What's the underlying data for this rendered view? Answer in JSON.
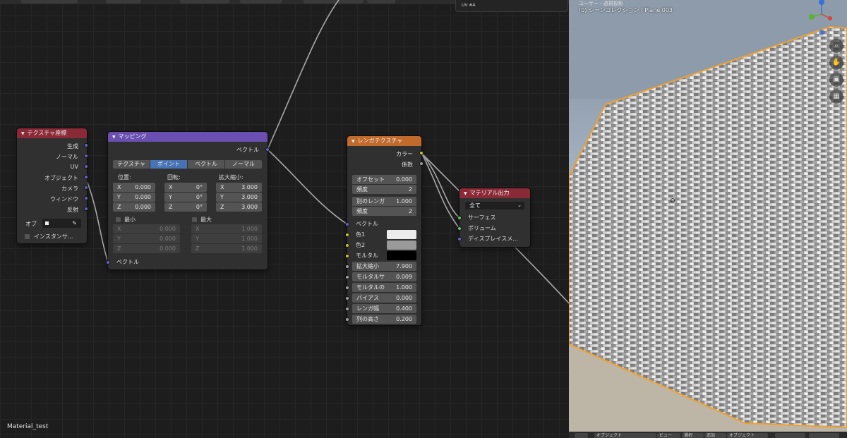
{
  "editor": {
    "material_name": "Material_test",
    "popup_text": "UV #A"
  },
  "nodes": {
    "texcoord": {
      "title": "テクスチャ座標",
      "outputs": [
        "生成",
        "ノーマル",
        "UV",
        "オブジェクト",
        "カメラ",
        "ウィンドウ",
        "反射"
      ],
      "object_label": "オブ",
      "instancer_label": "インスタンサ..."
    },
    "mapping": {
      "title": "マッピング",
      "output_label": "ベクトル",
      "tabs": [
        "テクスチャ",
        "ポイント",
        "ベクトル",
        "ノーマル"
      ],
      "active_tab": "ポイント",
      "location_label": "位置:",
      "rotation_label": "回転:",
      "scale_label": "拡大縮小:",
      "axes": [
        "X",
        "Y",
        "Z"
      ],
      "location": [
        "0.000",
        "0.000",
        "0.000"
      ],
      "rotation": [
        "0°",
        "0°",
        "0°"
      ],
      "scale": [
        "3.000",
        "3.000",
        "3.000"
      ],
      "min_label": "最小",
      "max_label": "最大",
      "min_values": [
        "0.000",
        "0.000",
        "0.000"
      ],
      "max_values": [
        "1.000",
        "1.000",
        "1.000"
      ],
      "input_label": "ベクトル"
    },
    "brick": {
      "title": "レンガテクスチャ",
      "outputs": [
        "カラー",
        "係数"
      ],
      "offset_label": "オフセット",
      "offset_value": "0.000",
      "freq_label": "頻度",
      "offset_freq": "2",
      "squash_label": "別のレンガ",
      "squash_value": "1.000",
      "squash_freq": "2",
      "inputs": [
        "ベクトル",
        "色1",
        "色2",
        "モルタル"
      ],
      "colors": {
        "color1": "#ececec",
        "color2": "#9a9a9a",
        "mortar": "#000000"
      },
      "params": [
        {
          "label": "拡大縮小",
          "value": "7.900"
        },
        {
          "label": "モルタルサ",
          "value": "0.009"
        },
        {
          "label": "モルタルの",
          "value": "1.000"
        },
        {
          "label": "バイアス",
          "value": "0.000"
        },
        {
          "label": "レンガ幅",
          "value": "0.400"
        },
        {
          "label": "列の高さ",
          "value": "0.200"
        }
      ]
    },
    "output": {
      "title": "マテリアル出力",
      "target": "全て",
      "inputs": [
        "サーフェス",
        "ボリューム",
        "ディスプレイスメ..."
      ]
    }
  },
  "viewport": {
    "title": "(0) シーンコレクション | Plane.003",
    "header_fragment": "ユーザー・透視投影",
    "nav_icons": [
      "zoom-icon",
      "hand-pan-icon",
      "camera-icon",
      "grid-view-icon"
    ],
    "bottom_items": [
      "オブジェクト",
      "ビュー",
      "選択",
      "追加",
      "オブジェクト"
    ]
  },
  "colors": {
    "accent_blue": "#4772b3",
    "texcoord_header": "#8b2a37",
    "mapping_header": "#6a4fb0",
    "brick_header": "#c06a2c",
    "output_header": "#8b2a37",
    "selection_outline": "#f0a030"
  }
}
